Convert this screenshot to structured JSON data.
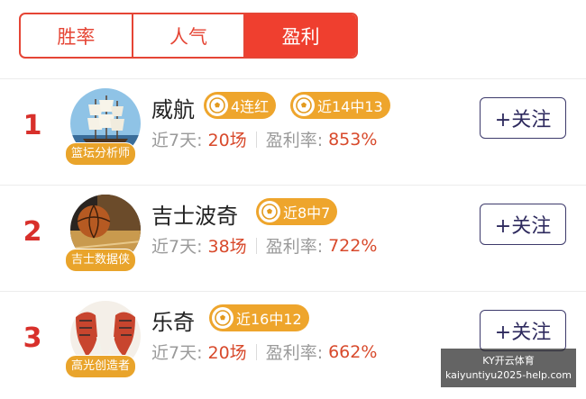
{
  "tabs": [
    {
      "label": "胜率",
      "active": false
    },
    {
      "label": "人气",
      "active": false
    },
    {
      "label": "盈利",
      "active": true
    }
  ],
  "rows": [
    {
      "rank": "1",
      "badge": "篮坛分析师",
      "name": "威航",
      "tags": [
        "4连红",
        "近14中13"
      ],
      "days_label": "近7天:",
      "days_value": "20场",
      "rate_label": "盈利率:",
      "rate_value": "853%",
      "follow_label": "+关注",
      "avatar_icon": "sailing-ship-avatar"
    },
    {
      "rank": "2",
      "badge": "吉士数据侠",
      "name": "吉士波奇",
      "tags": [
        "近8中7"
      ],
      "days_label": "近7天:",
      "days_value": "38场",
      "rate_label": "盈利率:",
      "rate_value": "722%",
      "follow_label": "+关注",
      "avatar_icon": "basketball-avatar"
    },
    {
      "rank": "3",
      "badge": "高光创造者",
      "name": "乐奇",
      "tags": [
        "近16中12"
      ],
      "days_label": "近7天:",
      "days_value": "20场",
      "rate_label": "盈利率:",
      "rate_value": "662%",
      "follow_label": "+关注",
      "avatar_icon": "elephants-avatar"
    }
  ],
  "watermark": {
    "line1": "KY开云体育",
    "line2": "kaiyuntiyu2025-help.com"
  },
  "colors": {
    "accent": "#ef3f2f",
    "tag": "#eea52c",
    "rank": "#d8302b",
    "value": "#d84a2c"
  }
}
